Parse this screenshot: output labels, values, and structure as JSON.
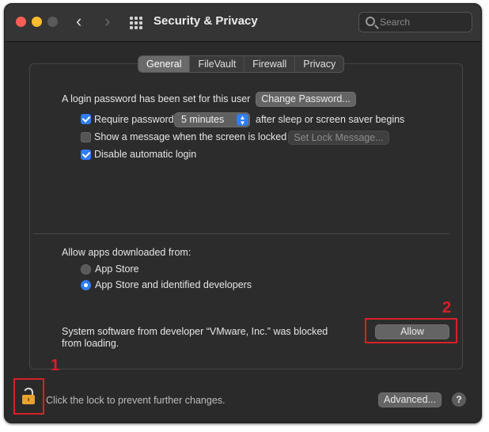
{
  "window": {
    "title": "Security & Privacy",
    "search_placeholder": "Search"
  },
  "tabs": [
    {
      "label": "General",
      "active": true
    },
    {
      "label": "FileVault",
      "active": false
    },
    {
      "label": "Firewall",
      "active": false
    },
    {
      "label": "Privacy",
      "active": false
    }
  ],
  "general": {
    "login_password_text": "A login password has been set for this user",
    "change_password_label": "Change Password...",
    "require_password_label": "Require password",
    "require_password_checked": true,
    "require_password_delay": "5 minutes",
    "after_sleep_text": "after sleep or screen saver begins",
    "show_message_label": "Show a message when the screen is locked",
    "show_message_checked": false,
    "set_lock_message_label": "Set Lock Message...",
    "disable_auto_login_label": "Disable automatic login",
    "disable_auto_login_checked": true
  },
  "allow_apps": {
    "heading": "Allow apps downloaded from:",
    "options": [
      {
        "label": "App Store",
        "selected": false
      },
      {
        "label": "App Store and identified developers",
        "selected": true
      }
    ]
  },
  "blocked": {
    "line1": "System software from developer “VMware, Inc.” was blocked",
    "line2": "from loading.",
    "allow_label": "Allow"
  },
  "footer": {
    "lock_text": "Click the lock to prevent further changes.",
    "advanced_label": "Advanced...",
    "help_label": "?"
  },
  "annotations": {
    "one": "1",
    "two": "2",
    "color": "#d9202a"
  },
  "colors": {
    "accent": "#2f7ef6",
    "window_bg": "#2a2a2a",
    "lock_gold": "#e8a32c"
  }
}
